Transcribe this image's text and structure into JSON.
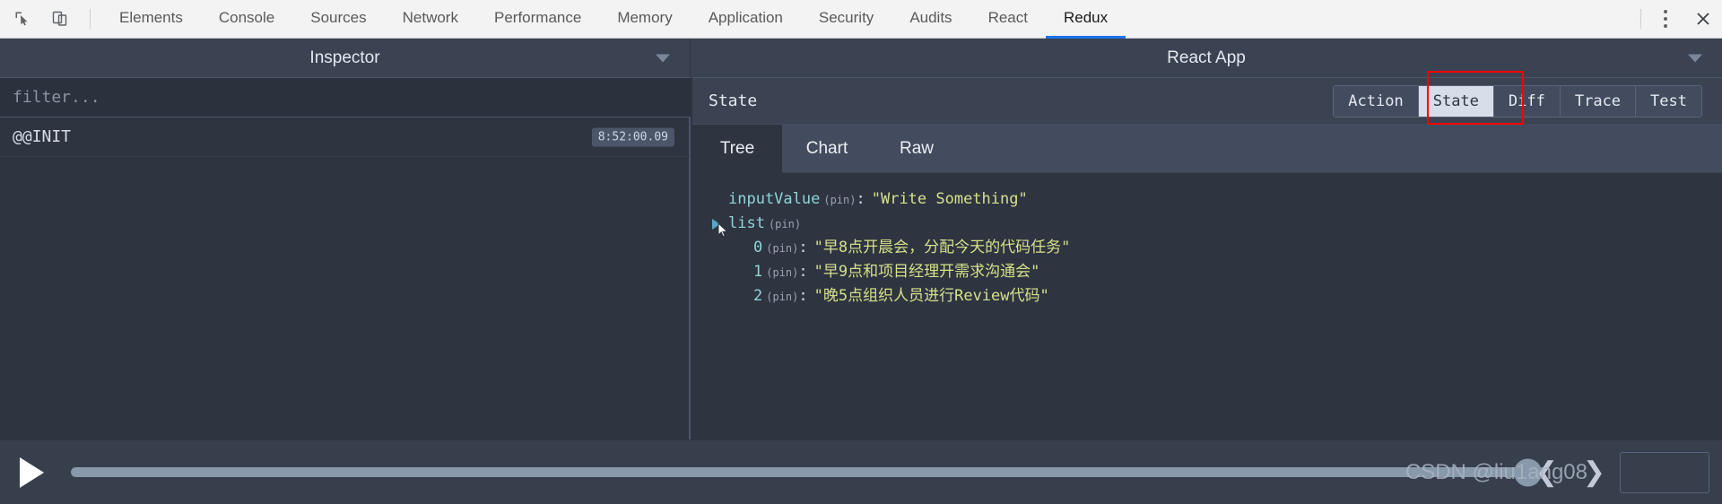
{
  "devtools": {
    "icons": [
      {
        "name": "inspect-element-icon",
        "label": "Inspect element"
      },
      {
        "name": "device-toolbar-icon",
        "label": "Toggle device toolbar"
      }
    ],
    "tabs": [
      {
        "label": "Elements",
        "active": false
      },
      {
        "label": "Console",
        "active": false
      },
      {
        "label": "Sources",
        "active": false
      },
      {
        "label": "Network",
        "active": false
      },
      {
        "label": "Performance",
        "active": false
      },
      {
        "label": "Memory",
        "active": false
      },
      {
        "label": "Application",
        "active": false
      },
      {
        "label": "Security",
        "active": false
      },
      {
        "label": "Audits",
        "active": false
      },
      {
        "label": "React",
        "active": false
      },
      {
        "label": "Redux",
        "active": true
      }
    ],
    "more_label": "More options",
    "close_label": "Close DevTools",
    "accent": "#1a73e8"
  },
  "panels": {
    "left_title": "Inspector",
    "right_title": "React App"
  },
  "inspector": {
    "filter_placeholder": "filter...",
    "actions": [
      {
        "type": "@@INIT",
        "time": "8:52:00.09"
      }
    ]
  },
  "state_panel": {
    "title": "State",
    "buttons": [
      {
        "label": "Action",
        "active": false
      },
      {
        "label": "State",
        "active": true
      },
      {
        "label": "Diff",
        "active": false
      },
      {
        "label": "Trace",
        "active": false
      },
      {
        "label": "Test",
        "active": false
      }
    ],
    "annotation_color": "#ff0000",
    "subtabs": [
      {
        "label": "Tree",
        "active": true
      },
      {
        "label": "Chart",
        "active": false
      },
      {
        "label": "Raw",
        "active": false
      }
    ]
  },
  "tree": {
    "pin_label": "(pin)",
    "colon": ":",
    "rows": [
      {
        "key": "inputValue",
        "pin": "(pin)",
        "value": "\"Write Something\"",
        "expandable": false,
        "child": false
      },
      {
        "key": "list",
        "pin": "(pin)",
        "value": "",
        "expandable": true,
        "child": false
      },
      {
        "key": "0",
        "pin": "(pin)",
        "value": "\"早8点开晨会，分配今天的代码任务\"",
        "expandable": false,
        "child": true
      },
      {
        "key": "1",
        "pin": "(pin)",
        "value": "\"早9点和项目经理开需求沟通会\"",
        "expandable": false,
        "child": true
      },
      {
        "key": "2",
        "pin": "(pin)",
        "value": "\"晚5点组织人员进行Review代码\"",
        "expandable": false,
        "child": true
      }
    ]
  },
  "player": {
    "play_label": "Play",
    "slider_value": 100,
    "prev_label": "❮",
    "next_label": "❯",
    "watermark": "CSDN @liu1ang08"
  }
}
